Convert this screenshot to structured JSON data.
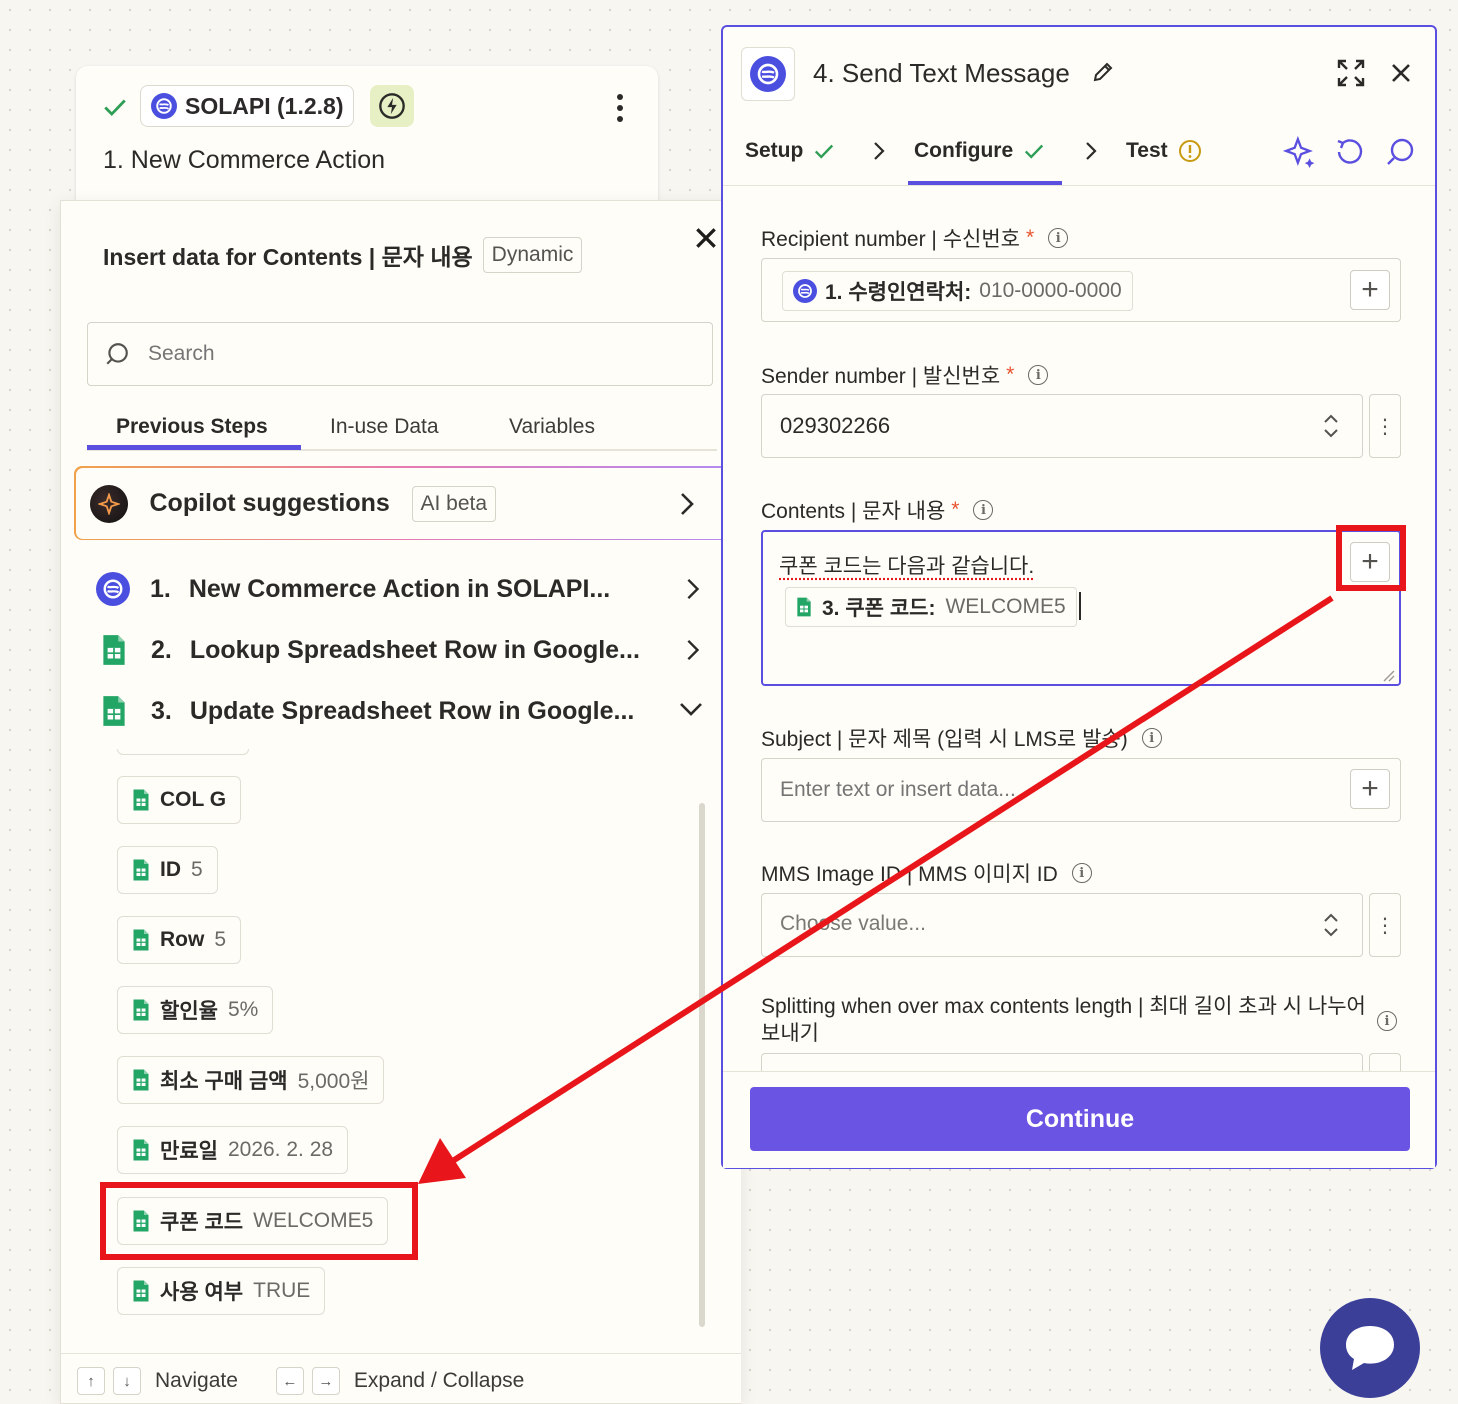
{
  "trigger": {
    "app_label": "SOLAPI (1.2.8)",
    "title": "1. New Commerce Action"
  },
  "insert_panel": {
    "title": "Insert data for Contents | 문자 내용",
    "badge": "Dynamic",
    "search_placeholder": "Search",
    "tabs": [
      {
        "label": "Previous Steps",
        "active": true
      },
      {
        "label": "In-use Data"
      },
      {
        "label": "Variables"
      }
    ],
    "copilot": {
      "label": "Copilot suggestions",
      "badge": "AI beta"
    },
    "steps": [
      {
        "num": "1.",
        "label": "New Commerce Action in SOLAPI...",
        "icon": "solapi-icon",
        "state": "collapsed"
      },
      {
        "num": "2.",
        "label": "Lookup Spreadsheet Row in Google...",
        "icon": "google-sheets-icon",
        "state": "collapsed"
      },
      {
        "num": "3.",
        "label": "Update Spreadsheet Row in Google...",
        "icon": "google-sheets-icon",
        "state": "expanded"
      }
    ],
    "data_items": [
      {
        "key": "COL G",
        "value": ""
      },
      {
        "key": "ID",
        "value": "5"
      },
      {
        "key": "Row",
        "value": "5"
      },
      {
        "key": "할인율",
        "value": "5%"
      },
      {
        "key": "최소 구매 금액",
        "value": "5,000원"
      },
      {
        "key": "만료일",
        "value": "2026. 2. 28"
      },
      {
        "key": "쿠폰 코드",
        "value": "WELCOME5"
      },
      {
        "key": "사용 여부",
        "value": "TRUE"
      }
    ],
    "footer": {
      "navigate": "Navigate",
      "expand": "Expand / Collapse",
      "up": "↑",
      "down": "↓",
      "left": "←",
      "right": "→"
    }
  },
  "config": {
    "title": "4. Send Text Message",
    "tabs": [
      {
        "label": "Setup",
        "status": "done"
      },
      {
        "label": "Configure",
        "status": "done",
        "active": true
      },
      {
        "label": "Test",
        "status": "warning"
      }
    ],
    "fields": {
      "recipient": {
        "label": "Recipient number | 수신번호",
        "required": "*",
        "chip_key": "1. 수령인연락처:",
        "chip_value": "010-0000-0000"
      },
      "sender": {
        "label": "Sender number | 발신번호",
        "required": "*",
        "value": "029302266"
      },
      "contents": {
        "label": "Contents | 문자 내용",
        "required": "*",
        "text": "쿠폰 코드는 다음과 같습니다.",
        "chip_key": "3. 쿠폰 코드:",
        "chip_value": "WELCOME5"
      },
      "subject": {
        "label": "Subject | 문자 제목 (입력 시 LMS로 발송)",
        "placeholder": "Enter text or insert data..."
      },
      "mms": {
        "label": "MMS Image ID | MMS 이미지 ID",
        "placeholder": "Choose value..."
      },
      "splitting": {
        "label": "Splitting when over max contents length | 최대 길이 초과 시 나누어 보내기"
      }
    },
    "continue_label": "Continue"
  },
  "colors": {
    "accent": "#5b4fe0",
    "highlight": "#e8161a",
    "success": "#2f9e57",
    "warning": "#c79a12"
  }
}
